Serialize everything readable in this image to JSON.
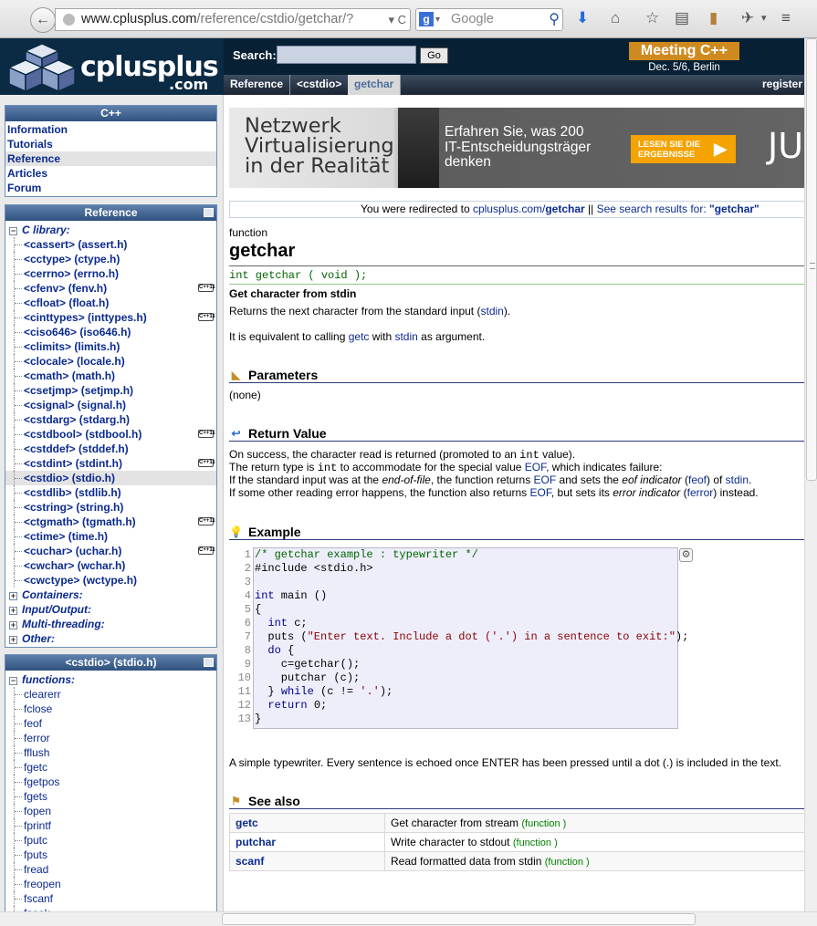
{
  "browser": {
    "url_host": "www.cplusplus.com",
    "url_path": "/reference/cstdio/getchar/?",
    "search_placeholder": "Google",
    "back_glyph": "←",
    "reload_glyph": "C",
    "dropdown_glyph": "▾"
  },
  "header": {
    "logo_text": "cplusplus",
    "logo_com": ".com",
    "search_label": "Search:",
    "search_value": "",
    "go_label": "Go",
    "promo_title": "Meeting C++",
    "promo_sub": "Dec. 5/6, Berlin",
    "breadcrumbs": [
      "Reference",
      "<cstdio>",
      "getchar"
    ],
    "register_label": "register"
  },
  "sidebar": {
    "nav_title": "C++",
    "nav_items": [
      "Information",
      "Tutorials",
      "Reference",
      "Articles",
      "Forum"
    ],
    "reference_title": "Reference",
    "c_library_label": "C library:",
    "c_library_items": [
      {
        "label": "<cassert> (assert.h)",
        "cpp11": false
      },
      {
        "label": "<cctype> (ctype.h)",
        "cpp11": false
      },
      {
        "label": "<cerrno> (errno.h)",
        "cpp11": false
      },
      {
        "label": "<cfenv> (fenv.h)",
        "cpp11": true
      },
      {
        "label": "<cfloat> (float.h)",
        "cpp11": false
      },
      {
        "label": "<cinttypes> (inttypes.h)",
        "cpp11": true
      },
      {
        "label": "<ciso646> (iso646.h)",
        "cpp11": false
      },
      {
        "label": "<climits> (limits.h)",
        "cpp11": false
      },
      {
        "label": "<clocale> (locale.h)",
        "cpp11": false
      },
      {
        "label": "<cmath> (math.h)",
        "cpp11": false
      },
      {
        "label": "<csetjmp> (setjmp.h)",
        "cpp11": false
      },
      {
        "label": "<csignal> (signal.h)",
        "cpp11": false
      },
      {
        "label": "<cstdarg> (stdarg.h)",
        "cpp11": false
      },
      {
        "label": "<cstdbool> (stdbool.h)",
        "cpp11": true
      },
      {
        "label": "<cstddef> (stddef.h)",
        "cpp11": false
      },
      {
        "label": "<cstdint> (stdint.h)",
        "cpp11": true
      },
      {
        "label": "<cstdio> (stdio.h)",
        "cpp11": false
      },
      {
        "label": "<cstdlib> (stdlib.h)",
        "cpp11": false
      },
      {
        "label": "<cstring> (string.h)",
        "cpp11": false
      },
      {
        "label": "<ctgmath> (tgmath.h)",
        "cpp11": true
      },
      {
        "label": "<ctime> (time.h)",
        "cpp11": false
      },
      {
        "label": "<cuchar> (uchar.h)",
        "cpp11": true
      },
      {
        "label": "<cwchar> (wchar.h)",
        "cpp11": false
      },
      {
        "label": "<cwctype> (wctype.h)",
        "cpp11": false
      }
    ],
    "other_sections": [
      "Containers:",
      "Input/Output:",
      "Multi-threading:",
      "Other:"
    ],
    "cpp11_badge": "C++11",
    "stdio_title": "<cstdio> (stdio.h)",
    "functions_label": "functions:",
    "functions": [
      "clearerr",
      "fclose",
      "feof",
      "ferror",
      "fflush",
      "fgetc",
      "fgetpos",
      "fgets",
      "fopen",
      "fprintf",
      "fputc",
      "fputs",
      "fread",
      "freopen",
      "fscanf",
      "fseek"
    ]
  },
  "ad": {
    "title_lines": [
      "Netzwerk",
      "Virtualisierung",
      "in der Realität"
    ],
    "text_lines": [
      "Erfahren Sie, was 200",
      "IT-Entscheidungsträger",
      "denken"
    ],
    "button_lines": [
      "LESEN SIE DIE",
      "ERGEBNISSE"
    ],
    "button_arrow": "▶",
    "partial": "JU"
  },
  "page": {
    "redirect_prefix": "You were redirected to ",
    "redirect_link": "cplusplus.com/",
    "redirect_link_bold": "getchar",
    "redirect_sep": " || ",
    "redirect_search": "See search results for: ",
    "redirect_query": "\"getchar\"",
    "kind": "function",
    "name": "getchar",
    "prototype": "int getchar ( void );",
    "short_desc": "Get character from stdin",
    "desc1_pre": "Returns the next character from the standard input (",
    "desc1_link": "stdin",
    "desc1_post": ").",
    "desc2_pre": "It is equivalent to calling ",
    "desc2_link1": "getc",
    "desc2_mid": " with ",
    "desc2_link2": "stdin",
    "desc2_post": " as argument.",
    "params_title": "Parameters",
    "params_text": "(none)",
    "return_title": "Return Value",
    "ret1_pre": "On success, the character read is returned (promoted to an ",
    "ret1_mono": "int",
    "ret1_post": " value).",
    "ret2_pre": "The return type is ",
    "ret2_mono": "int",
    "ret2_mid": " to accommodate for the special value ",
    "ret2_link": "EOF",
    "ret2_post": ", which indicates failure:",
    "ret3_pre": "If the standard input was at the ",
    "ret3_em": "end-of-file",
    "ret3_mid": ", the function returns ",
    "ret3_link": "EOF",
    "ret3_mid2": " and sets the ",
    "ret3_em2": "eof indicator",
    "ret3_paren_open": " (",
    "ret3_link2": "feof",
    "ret3_of": ") of ",
    "ret3_link3": "stdin",
    "ret3_post": ".",
    "ret4_pre": "If some other reading error happens, the function also returns ",
    "ret4_link": "EOF",
    "ret4_mid": ", but sets its ",
    "ret4_em": "error indicator",
    "ret4_paren_open": " (",
    "ret4_link2": "ferror",
    "ret4_post": ") instead.",
    "example_title": "Example",
    "code_lines": [
      "/* getchar example : typewriter */",
      "#include <stdio.h>",
      "",
      "int main ()",
      "{",
      "  int c;",
      "  puts (\"Enter text. Include a dot ('.') in a sentence to exit:\");",
      "  do {",
      "    c=getchar();",
      "    putchar (c);",
      "  } while (c != '.');",
      "  return 0;",
      "}"
    ],
    "example_caption": "A simple typewriter. Every sentence is echoed once ENTER has been pressed until a dot (.) is included in the text.",
    "seealso_title": "See also",
    "seealso": [
      {
        "name": "getc",
        "desc": "Get character from stream",
        "kind": "(function )"
      },
      {
        "name": "putchar",
        "desc": "Write character to stdout",
        "kind": "(function )"
      },
      {
        "name": "scanf",
        "desc": "Read formatted data from stdin",
        "kind": "(function )"
      }
    ]
  },
  "colors": {
    "link": "#0a2a90",
    "header": "#082033",
    "accent": "#cf8a1f",
    "code_bg": "#eeeefb"
  }
}
